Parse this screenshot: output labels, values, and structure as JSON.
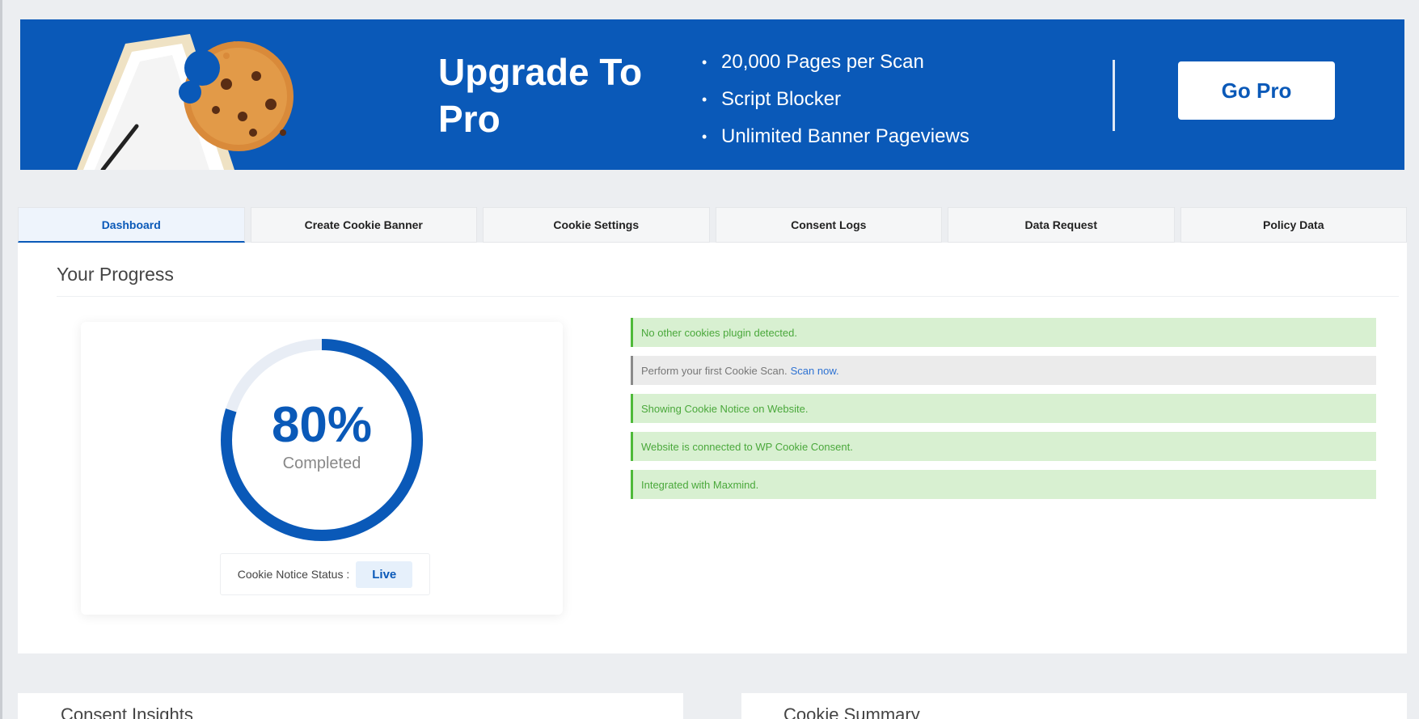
{
  "banner": {
    "title": "Upgrade To Pro",
    "features": [
      "20,000 Pages per Scan",
      "Script Blocker",
      "Unlimited Banner Pageviews"
    ],
    "cta_label": "Go Pro",
    "bg_color": "#0a59b8"
  },
  "tabs": [
    {
      "label": "Dashboard",
      "active": true
    },
    {
      "label": "Create Cookie Banner",
      "active": false
    },
    {
      "label": "Cookie Settings",
      "active": false
    },
    {
      "label": "Consent Logs",
      "active": false
    },
    {
      "label": "Data Request",
      "active": false
    },
    {
      "label": "Policy Data",
      "active": false
    }
  ],
  "progress": {
    "heading": "Your Progress",
    "percent_text": "80%",
    "percent_value": 80,
    "completed_label": "Completed",
    "status_label": "Cookie Notice Status :",
    "status_value": "Live"
  },
  "notices": [
    {
      "text": "No other cookies plugin detected.",
      "type": "success",
      "link": ""
    },
    {
      "text": "Perform your first Cookie Scan.",
      "type": "info",
      "link": "Scan now."
    },
    {
      "text": "Showing Cookie Notice on Website.",
      "type": "success",
      "link": ""
    },
    {
      "text": "Website is connected to WP Cookie Consent.",
      "type": "success",
      "link": ""
    },
    {
      "text": "Integrated with Maxmind.",
      "type": "success",
      "link": ""
    }
  ],
  "bottom": {
    "left_title": "Consent Insights",
    "right_title": "Cookie Summary"
  },
  "colors": {
    "accent": "#0a59b8",
    "success_bg": "#d8f0d1",
    "success_text": "#4aa83b"
  }
}
